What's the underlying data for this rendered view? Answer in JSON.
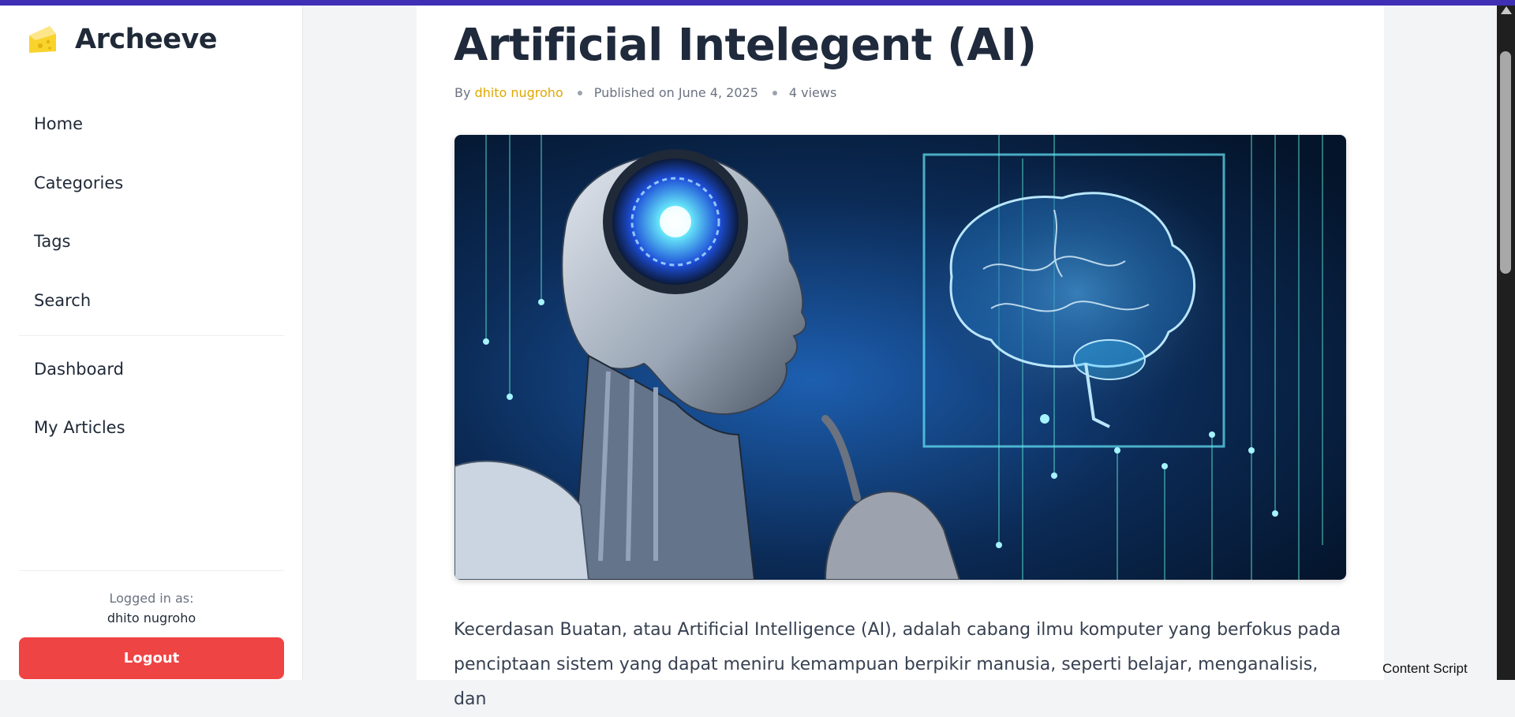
{
  "brand": {
    "name": "Archeeve",
    "logo_icon": "cheese-icon",
    "logo_color": "#f8d32b"
  },
  "nav": {
    "primary": [
      "Home",
      "Categories",
      "Tags",
      "Search"
    ],
    "secondary": [
      "Dashboard",
      "My Articles"
    ]
  },
  "user": {
    "logged_label": "Logged in as:",
    "name": "dhito nugroho",
    "logout_label": "Logout"
  },
  "article": {
    "title": "Artificial Intelegent (AI)",
    "by_label": "By",
    "author": "dhito nugroho",
    "published": "Published on June 4, 2025",
    "views": "4 views",
    "paragraph": "Kecerdasan Buatan, atau Artificial Intelligence (AI), adalah cabang ilmu komputer yang berfokus pada penciptaan sistem yang dapat meniru kemampuan berpikir manusia, seperti belajar, menganalisis, dan"
  },
  "overlay": {
    "content_script": "Content Script"
  },
  "colors": {
    "accent_bar": "#3f2fb5",
    "author": "#e0a800",
    "logout": "#ef4444"
  }
}
